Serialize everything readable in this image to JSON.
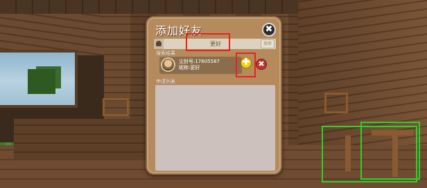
{
  "dialog": {
    "title": "添加好友",
    "close_label": "✖"
  },
  "search": {
    "value": "更好",
    "button_label": "搜索"
  },
  "results": {
    "label": "搜索结果",
    "items": [
      {
        "line1": "尘封号:17605587",
        "line2": "昵称:更好"
      }
    ]
  },
  "requests": {
    "label": "申请列表"
  },
  "actions": {
    "add_label": "✚",
    "remove_label": "✖"
  },
  "icons": {
    "search": "person-search-icon",
    "add": "plus-icon",
    "remove": "x-icon",
    "close": "close-icon"
  },
  "colors": {
    "dialog_bg": "#b58a5c",
    "add_button": "#f2d012",
    "remove_button": "#c9302c",
    "highlight": "#e8231e",
    "selection_outline": "#2bd22b"
  }
}
